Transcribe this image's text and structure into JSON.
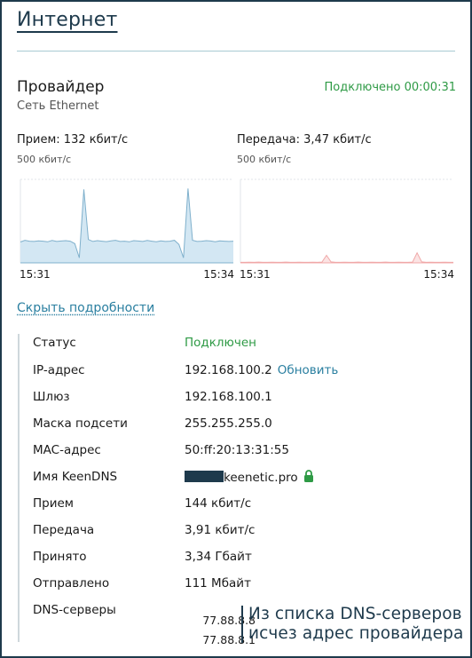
{
  "page": {
    "title": "Интернет"
  },
  "provider": {
    "name": "Провайдер",
    "subtitle": "Сеть Ethernet",
    "status": "Подключено 00:00:31"
  },
  "charts": {
    "rx": {
      "label": "Прием: 132 кбит/с",
      "scale": "500 кбит/с",
      "start": "15:31",
      "end": "15:34",
      "fill": "#d3e7f3",
      "stroke": "#7fb0cc"
    },
    "tx": {
      "label": "Передача: 3,47 кбит/с",
      "scale": "500 кбит/с",
      "start": "15:31",
      "end": "15:34",
      "fill": "#fbe4e4",
      "stroke": "#f0a8a8"
    }
  },
  "chart_data": [
    {
      "type": "area",
      "title": "Прием: 132 кбит/с",
      "ylabel": "500 кбит/с",
      "x_ticks": [
        "15:31",
        "15:34"
      ],
      "ylim": [
        0,
        500
      ],
      "series": [
        {
          "values": [
            125,
            135,
            130,
            128,
            132,
            130,
            126,
            134,
            128,
            131,
            133,
            130,
            115,
            30,
            440,
            140,
            128,
            133,
            130,
            127,
            132,
            135,
            128,
            130,
            126,
            133,
            131,
            128,
            134,
            130,
            126,
            132,
            128,
            130,
            135,
            110,
            30,
            445,
            135,
            128,
            130,
            133,
            131,
            126,
            132,
            130,
            128,
            130
          ]
        }
      ]
    },
    {
      "type": "area",
      "title": "Передача: 3,47 кбит/с",
      "ylabel": "500 кбит/с",
      "x_ticks": [
        "15:31",
        "15:34"
      ],
      "ylim": [
        0,
        500
      ],
      "series": [
        {
          "values": [
            3,
            3,
            4,
            3,
            5,
            3,
            3,
            4,
            3,
            3,
            5,
            3,
            3,
            4,
            3,
            3,
            4,
            3,
            5,
            45,
            6,
            3,
            3,
            4,
            3,
            3,
            5,
            3,
            3,
            4,
            3,
            3,
            5,
            3,
            3,
            4,
            3,
            3,
            5,
            60,
            6,
            3,
            4,
            3,
            3,
            4,
            3,
            3
          ]
        }
      ]
    }
  ],
  "details": {
    "toggle_label": "Скрыть подробности",
    "rows": [
      {
        "label": "Статус",
        "value": "Подключен"
      },
      {
        "label": "IP-адрес",
        "value": "192.168.100.2"
      },
      {
        "label": "Шлюз",
        "value": "192.168.100.1"
      },
      {
        "label": "Маска подсети",
        "value": "255.255.255.0"
      },
      {
        "label": "MAC-адрес",
        "value": "50:ff:20:13:31:55"
      },
      {
        "label": "Имя KeenDNS",
        "value": "keenetic.pro"
      },
      {
        "label": "Прием",
        "value": "144 кбит/с"
      },
      {
        "label": "Передача",
        "value": "3,91 кбит/с"
      },
      {
        "label": "Принято",
        "value": "3,34 Гбайт"
      },
      {
        "label": "Отправлено",
        "value": "111 Мбайт"
      },
      {
        "label": "DNS-серверы",
        "value": ""
      }
    ],
    "refresh_label": "Обновить",
    "dns_servers": [
      "77.88.8.8",
      "77.88.8.1"
    ]
  },
  "annotation": {
    "line1": "Из списка DNS-серверов",
    "line2": "исчез адрес провайдера"
  },
  "colors": {
    "accent": "#1e3a4c",
    "link": "#2a7fa0",
    "ok_green": "#2e9a45"
  },
  "icons": {
    "keendns_lock": "lock-icon"
  }
}
